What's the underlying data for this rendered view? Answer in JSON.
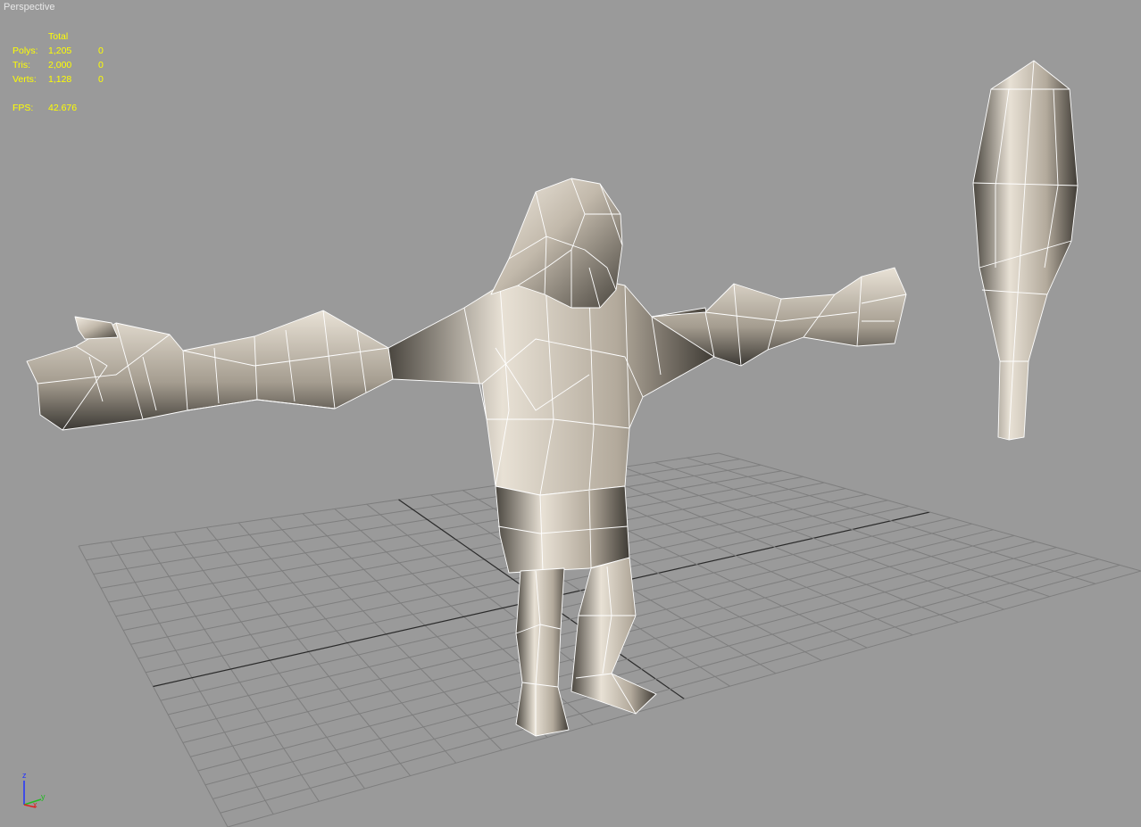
{
  "viewport": {
    "label": "Perspective"
  },
  "stats": {
    "header": "Total",
    "rows": [
      {
        "key": "Polys:",
        "total": "1,205",
        "selected": "0"
      },
      {
        "key": "Tris:",
        "total": "2,000",
        "selected": "0"
      },
      {
        "key": "Verts:",
        "total": "1,128",
        "selected": "0"
      }
    ],
    "fps_key": "FPS:",
    "fps_value": "42.676"
  },
  "axis_gizmo": {
    "z_label": "z",
    "y_label": "y",
    "x_label": "x"
  },
  "colors": {
    "background": "#9a9a9a",
    "grid": "#7e7e7e",
    "grid_axis": "#2a2a2a",
    "stats_text": "#ffff00",
    "mesh_base": "#c9c0b2",
    "wire": "#ffffff"
  }
}
